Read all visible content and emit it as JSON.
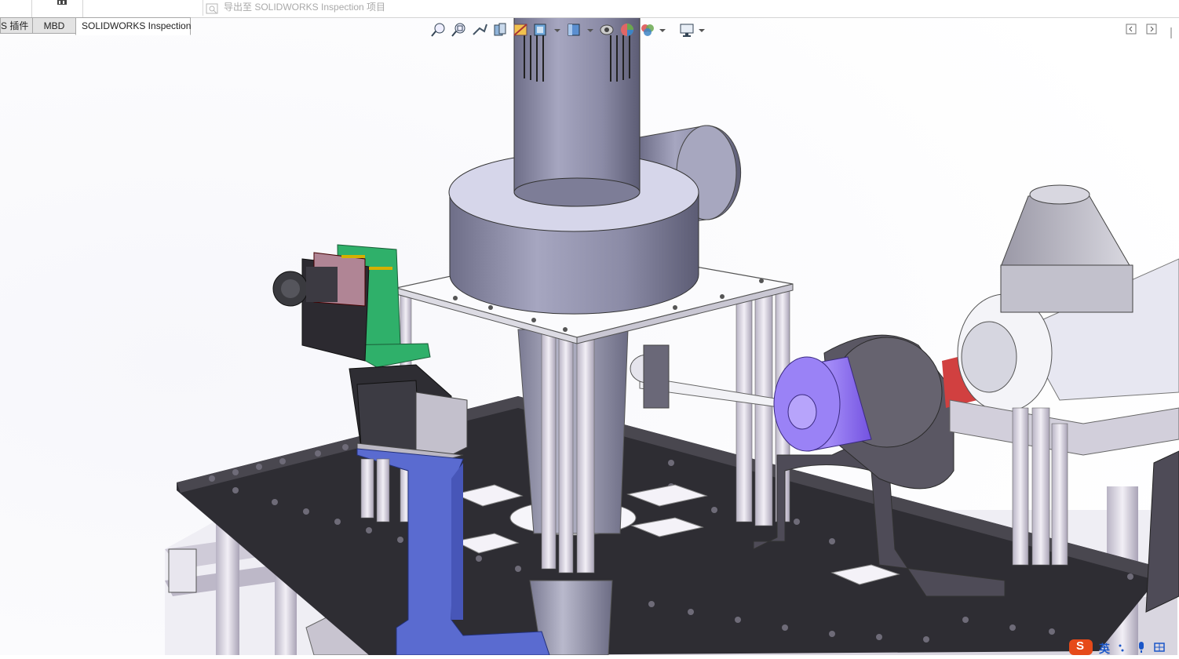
{
  "window": {
    "export_command": "导出至 SOLIDWORKS Inspection 项目"
  },
  "tabs": [
    {
      "label": "S 插件"
    },
    {
      "label": "MBD"
    },
    {
      "label": "SOLIDWORKS Inspection",
      "active": true
    }
  ],
  "heads_up_toolbar": {
    "icons": [
      "zoom-to-fit-icon",
      "zoom-to-area-icon",
      "previous-view-icon",
      "section-view-icon",
      "dynamic-annotation-icon",
      "view-orientation-icon",
      "display-style-icon",
      "hide-show-items-icon",
      "edit-appearance-icon",
      "apply-scene-icon",
      "view-settings-icon"
    ]
  },
  "panel_controls": {
    "icons": [
      "restore-panel-icon",
      "expand-panel-icon"
    ]
  },
  "taskbar_ime": {
    "logo": "S",
    "language": "英"
  },
  "colors": {
    "viewport_bg": "#ffffff",
    "board": "#2b2a2f",
    "aluminum": "#d8d4de",
    "cyclone": "#8e8ea6",
    "motor_purple": "#8b6af0",
    "bracket_blue": "#5a6bd0",
    "pcb_green": "#2fb06a"
  }
}
